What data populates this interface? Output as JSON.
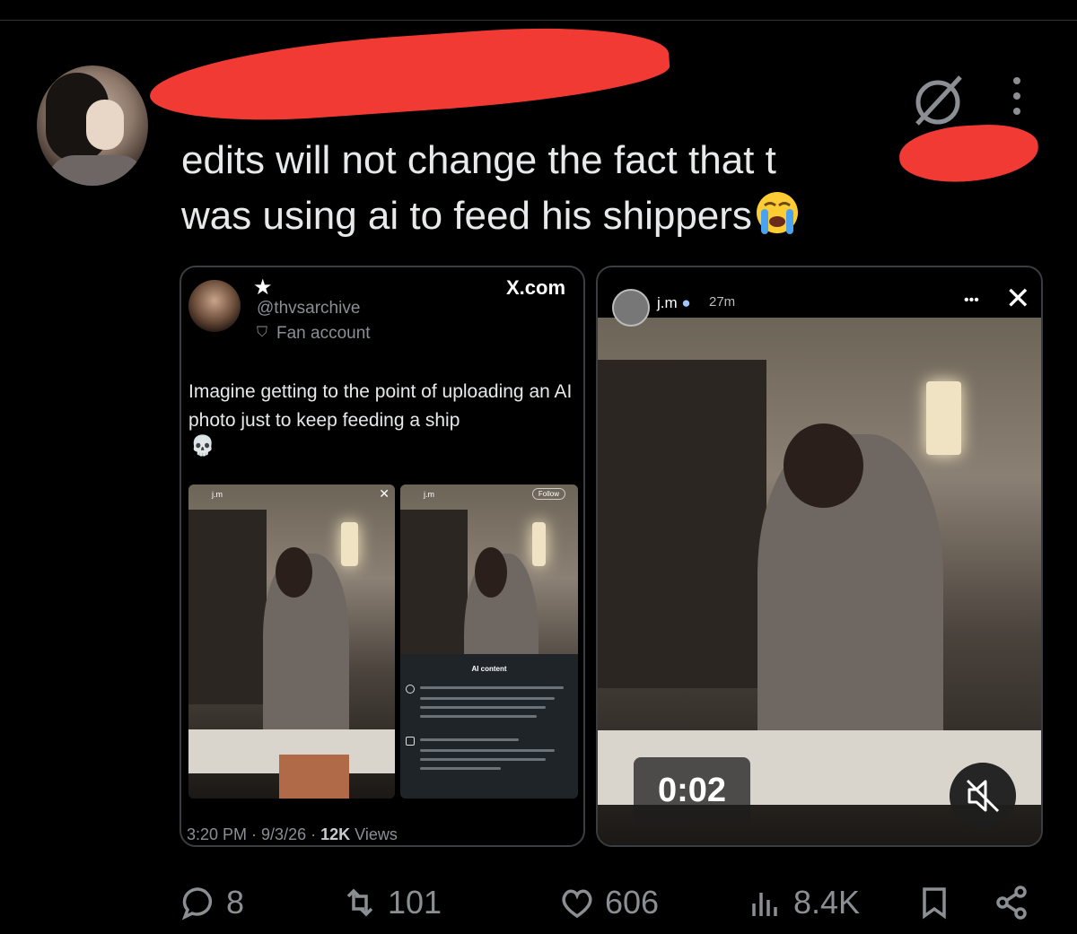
{
  "tweet": {
    "text_line1": "edits will not change the fact that t",
    "text_line2": "was using ai to feed his shippers",
    "emoji": "loudly-crying-face"
  },
  "embedded_tweet": {
    "star": "★",
    "handle": "@thvsarchive",
    "account_label": "Fan account",
    "source": "X.com",
    "text": "Imagine getting to the point of uploading an AI photo just to keep feeding a ship",
    "emoji": "💀",
    "time": "3:20 PM",
    "date": "9/3/26",
    "views_count": "12K",
    "views_label": "Views",
    "screenshot_b": {
      "ai_title": "AI content",
      "follow_label": "Follow"
    }
  },
  "story_card": {
    "username": "j.m",
    "time": "27m",
    "video_time": "0:02"
  },
  "actions": {
    "replies": "8",
    "reposts": "101",
    "likes": "606",
    "views": "8.4K"
  },
  "colors": {
    "background": "#000000",
    "text": "#e7e9ea",
    "muted": "#8b8f94",
    "redaction": "#f03a33"
  }
}
